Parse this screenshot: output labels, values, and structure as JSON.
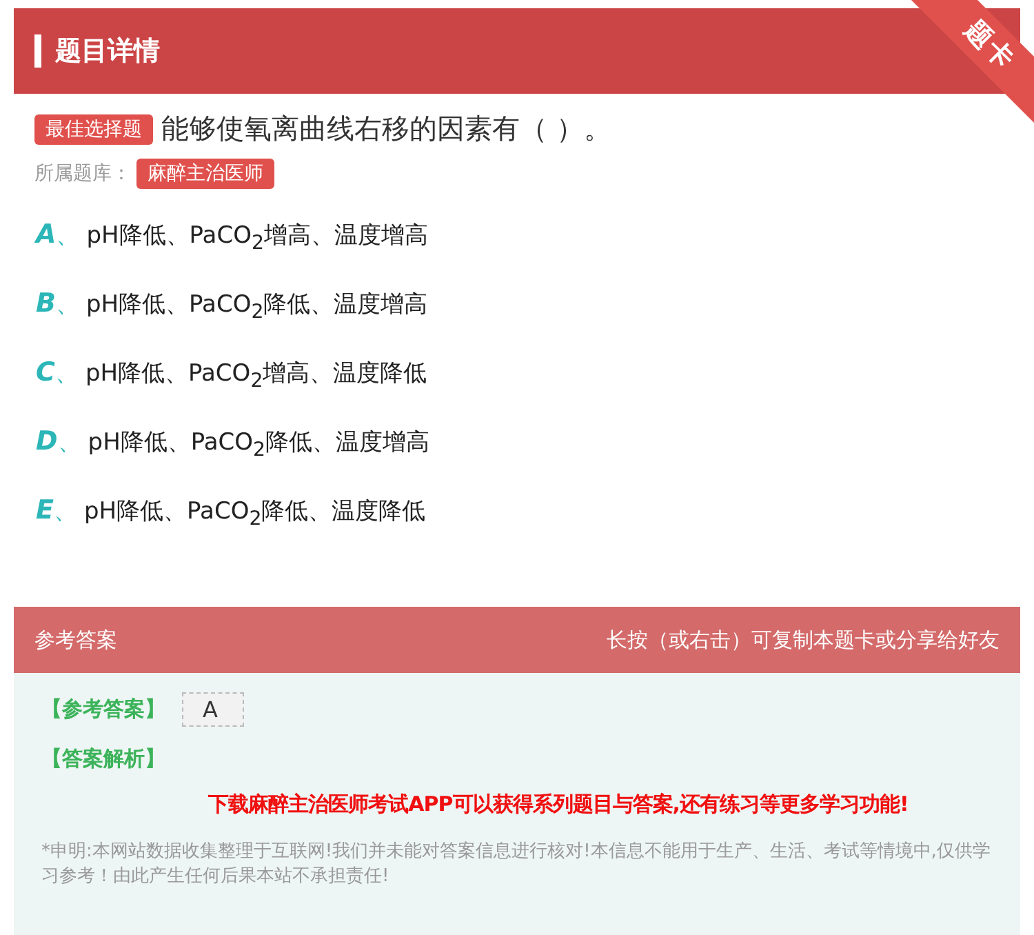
{
  "header": {
    "title": "题目详情",
    "ribbon": "题卡"
  },
  "question": {
    "type_badge": "最佳选择题",
    "text": "能够使氧离曲线右移的因素有（ ）。",
    "bank_label": "所属题库：",
    "bank": "麻醉主治医师"
  },
  "options": [
    {
      "letter": "A",
      "separator": "、",
      "text": "pH降低、PaCO$_{2}$增高、温度增高"
    },
    {
      "letter": "B",
      "separator": "、",
      "text": "pH降低、PaCO$_{2}$降低、温度增高"
    },
    {
      "letter": "C",
      "separator": "、",
      "text": "pH降低、PaCO$_{2}$增高、温度降低"
    },
    {
      "letter": "D",
      "separator": "、",
      "text": "pH降低、PaCO$_{2}$降低、温度增高"
    },
    {
      "letter": "E",
      "separator": "、",
      "text": "pH降低、PaCO$_{2}$降低、温度降低"
    }
  ],
  "answer_panel": {
    "title": "参考答案",
    "hint": "长按（或右击）可复制本题卡或分享给好友",
    "answer_label": "【参考答案】",
    "answer": "A",
    "analysis_label": "【答案解析】",
    "promo": "下载麻醉主治医师考试APP可以获得系列题目与答案,还有练习等更多学习功能!",
    "disclaimer": "*申明:本网站数据收集整理于互联网!我们并未能对答案信息进行核对!本信息不能用于生产、生活、考试等情境中,仅供学习参考！由此产生任何后果本站不承担责任!"
  }
}
